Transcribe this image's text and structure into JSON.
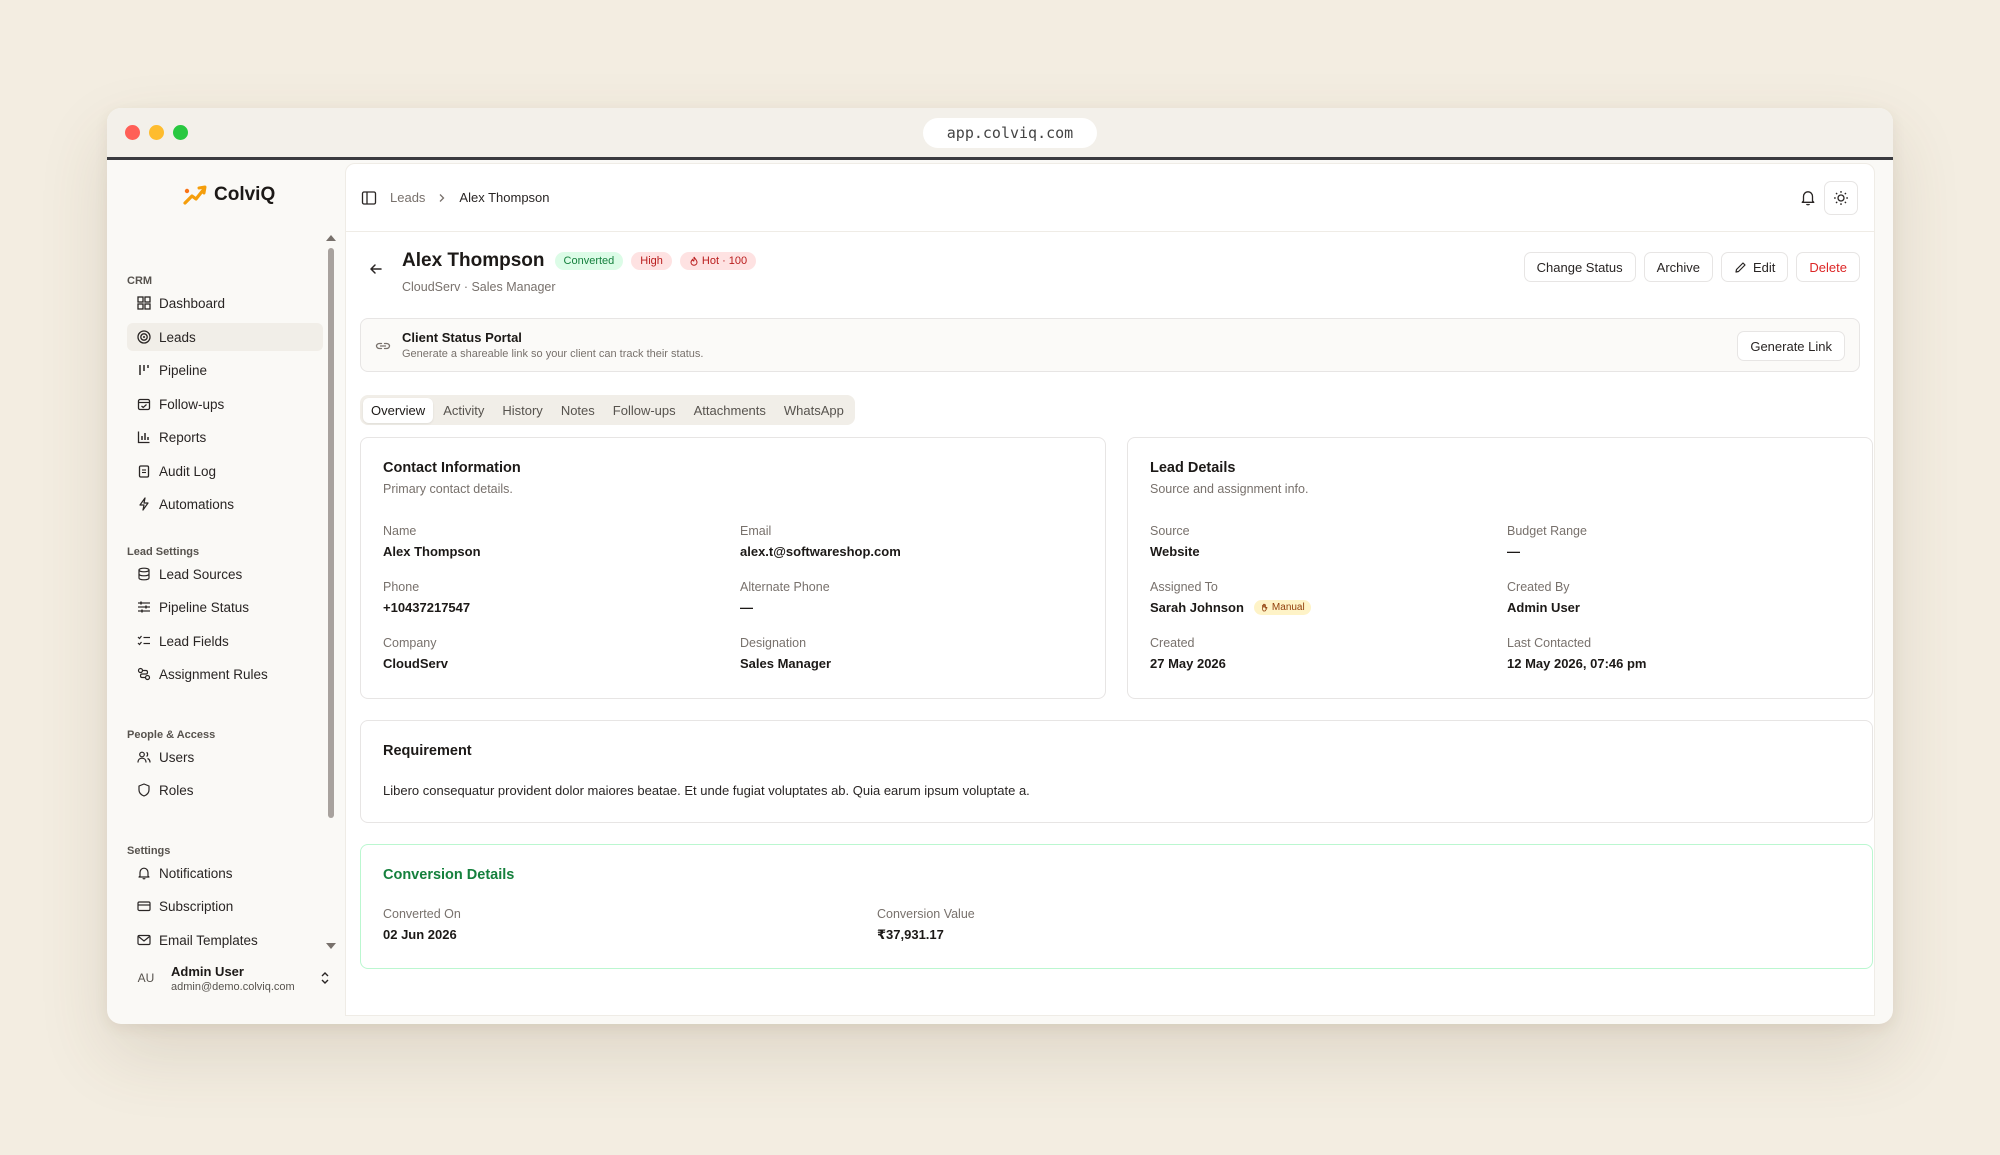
{
  "browser": {
    "url": "app.colviq.com"
  },
  "app": {
    "name": "ColviQ",
    "brand_color": "#f59e0b"
  },
  "sidebar": {
    "sections": [
      {
        "label": "CRM",
        "items": [
          "Dashboard",
          "Leads",
          "Pipeline",
          "Follow-ups",
          "Reports",
          "Audit Log",
          "Automations"
        ]
      },
      {
        "label": "Lead Settings",
        "items": [
          "Lead Sources",
          "Pipeline Status",
          "Lead Fields",
          "Assignment Rules"
        ]
      },
      {
        "label": "People & Access",
        "items": [
          "Users",
          "Roles"
        ]
      },
      {
        "label": "Settings",
        "items": [
          "Notifications",
          "Subscription",
          "Email Templates"
        ]
      }
    ],
    "active": "Leads",
    "user": {
      "initials": "AU",
      "name": "Admin User",
      "email": "admin@demo.colviq.com"
    }
  },
  "breadcrumb": {
    "parent": "Leads",
    "current": "Alex Thompson"
  },
  "lead": {
    "name": "Alex Thompson",
    "badges": {
      "status": "Converted",
      "priority": "High",
      "score": "Hot · 100"
    },
    "subtitle": "CloudServ · Sales Manager"
  },
  "actions": {
    "change_status": "Change Status",
    "archive": "Archive",
    "edit": "Edit",
    "delete": "Delete"
  },
  "portal": {
    "title": "Client Status Portal",
    "subtitle": "Generate a shareable link so your client can track their status.",
    "button": "Generate Link"
  },
  "tabs": [
    "Overview",
    "Activity",
    "History",
    "Notes",
    "Follow-ups",
    "Attachments",
    "WhatsApp"
  ],
  "contact": {
    "title": "Contact Information",
    "subtitle": "Primary contact details.",
    "fields": [
      {
        "label": "Name",
        "value": "Alex Thompson"
      },
      {
        "label": "Email",
        "value": "alex.t@softwareshop.com"
      },
      {
        "label": "Phone",
        "value": "+10437217547"
      },
      {
        "label": "Alternate Phone",
        "value": "—"
      },
      {
        "label": "Company",
        "value": "CloudServ"
      },
      {
        "label": "Designation",
        "value": "Sales Manager"
      }
    ]
  },
  "details": {
    "title": "Lead Details",
    "subtitle": "Source and assignment info.",
    "fields": [
      {
        "label": "Source",
        "value": "Website"
      },
      {
        "label": "Budget Range",
        "value": "—"
      },
      {
        "label": "Assigned To",
        "value": "Sarah Johnson",
        "tag": "Manual"
      },
      {
        "label": "Created By",
        "value": "Admin User"
      },
      {
        "label": "Created",
        "value": "27 May 2026"
      },
      {
        "label": "Last Contacted",
        "value": "12 May 2026, 07:46 pm"
      }
    ]
  },
  "requirement": {
    "title": "Requirement",
    "text": "Libero consequatur provident dolor maiores beatae. Et unde fugiat voluptates ab. Quia earum ipsum voluptate a."
  },
  "conversion": {
    "title": "Conversion Details",
    "fields": [
      {
        "label": "Converted On",
        "value": "02 Jun 2026"
      },
      {
        "label": "Conversion Value",
        "value": "₹37,931.17"
      }
    ]
  }
}
